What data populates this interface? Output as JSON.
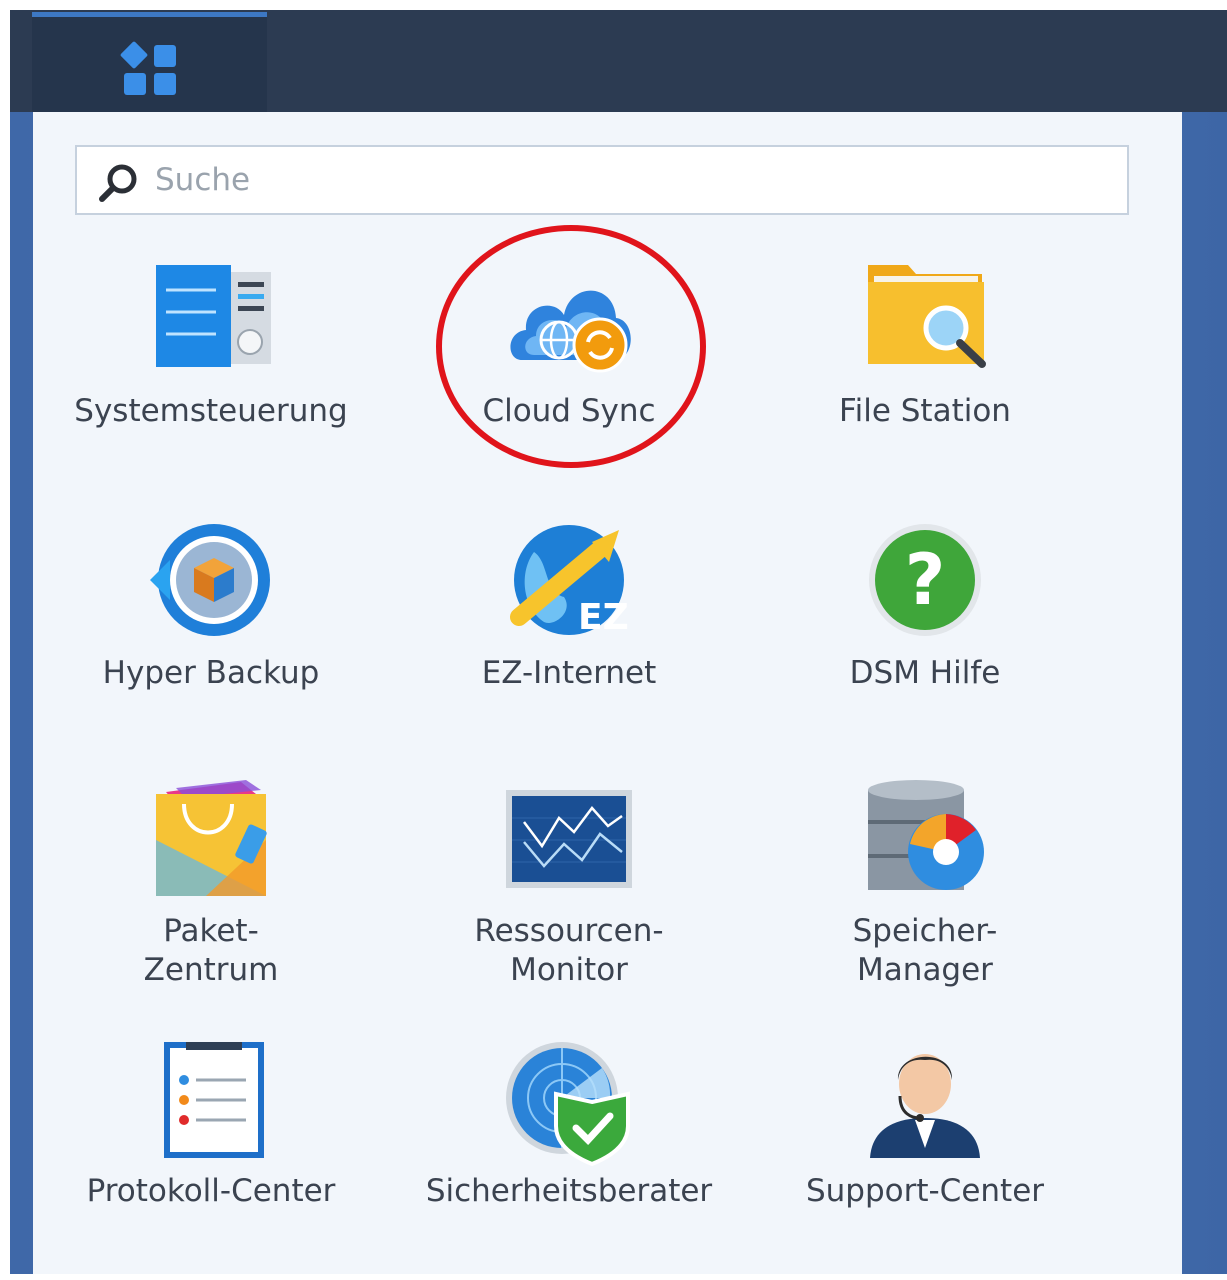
{
  "search": {
    "placeholder": "Suche",
    "value": ""
  },
  "apps": [
    {
      "id": "control-panel",
      "label": "Systemsteuerung"
    },
    {
      "id": "cloud-sync",
      "label": "Cloud Sync",
      "highlighted": true
    },
    {
      "id": "file-station",
      "label": "File Station"
    },
    {
      "id": "hyper-backup",
      "label": "Hyper Backup"
    },
    {
      "id": "ez-internet",
      "label": "EZ-Internet",
      "icon_text": "EZ"
    },
    {
      "id": "dsm-help",
      "label": "DSM Hilfe",
      "icon_text": "?"
    },
    {
      "id": "package-center",
      "label": "Paket-\nZentrum"
    },
    {
      "id": "resource-monitor",
      "label": "Ressourcen-\nMonitor"
    },
    {
      "id": "storage-manager",
      "label": "Speicher-\nManager"
    },
    {
      "id": "log-center",
      "label": "Protokoll-Center"
    },
    {
      "id": "security-advisor",
      "label": "Sicherheitsberater"
    },
    {
      "id": "support-center",
      "label": "Support-Center"
    }
  ],
  "colors": {
    "highlight": "#e0141b",
    "taskbar": "#2c3b52",
    "desktop": "#4b76b6",
    "accent": "#3d78c4"
  }
}
